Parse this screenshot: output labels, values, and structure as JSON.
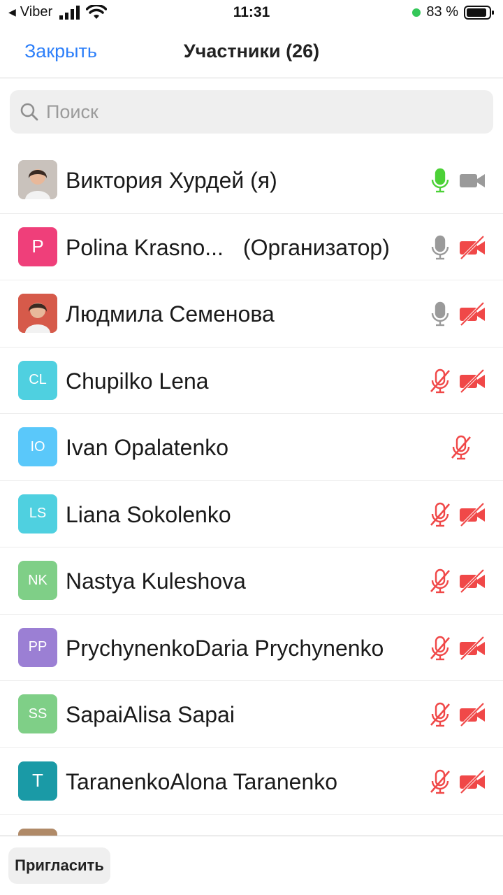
{
  "status_bar": {
    "back_app": "Viber",
    "time": "11:31",
    "battery_percent": "83 %"
  },
  "nav": {
    "close_label": "Закрыть",
    "title": "Участники (26)"
  },
  "search": {
    "placeholder": "Поиск"
  },
  "participants": [
    {
      "initials": "",
      "avatar_color": "#c9c2bc",
      "name": "Виктория  Хурдей (я)",
      "role": "",
      "mic": "active",
      "cam": "on"
    },
    {
      "initials": "P",
      "avatar_color": "#ef3f7a",
      "name": "Polina Krasno...",
      "role": "(Организатор)",
      "mic": "on",
      "cam": "off"
    },
    {
      "initials": "",
      "avatar_color": "#d65a4a",
      "name": "Людмила Семенова",
      "role": "",
      "mic": "on",
      "cam": "off"
    },
    {
      "initials": "CL",
      "avatar_color": "#4fd0e0",
      "name": "Chupilko Lena",
      "role": "",
      "mic": "muted",
      "cam": "off"
    },
    {
      "initials": "IO",
      "avatar_color": "#5ac8fa",
      "name": "Ivan Opalatenko",
      "role": "",
      "mic": "muted",
      "cam": "none"
    },
    {
      "initials": "LS",
      "avatar_color": "#4fd0e0",
      "name": "Liana Sokolenko",
      "role": "",
      "mic": "muted",
      "cam": "off"
    },
    {
      "initials": "NK",
      "avatar_color": "#7fcf87",
      "name": "Nastya Kuleshova",
      "role": "",
      "mic": "muted",
      "cam": "off"
    },
    {
      "initials": "PP",
      "avatar_color": "#9b7fd4",
      "name": "PrychynenkoDaria Prychynenko",
      "role": "",
      "mic": "muted",
      "cam": "off"
    },
    {
      "initials": "SS",
      "avatar_color": "#7fcf87",
      "name": "SapaiAlisa Sapai",
      "role": "",
      "mic": "muted",
      "cam": "off"
    },
    {
      "initials": "T",
      "avatar_color": "#1a9aa6",
      "name": "TaranenkoAlona Taranenko",
      "role": "",
      "mic": "muted",
      "cam": "off"
    }
  ],
  "bottom": {
    "invite_label": "Пригласить"
  },
  "colors": {
    "accent": "#2d7ff9",
    "mic_active": "#4cd137",
    "muted_red": "#f04848",
    "icon_gray": "#9a9a9a"
  }
}
